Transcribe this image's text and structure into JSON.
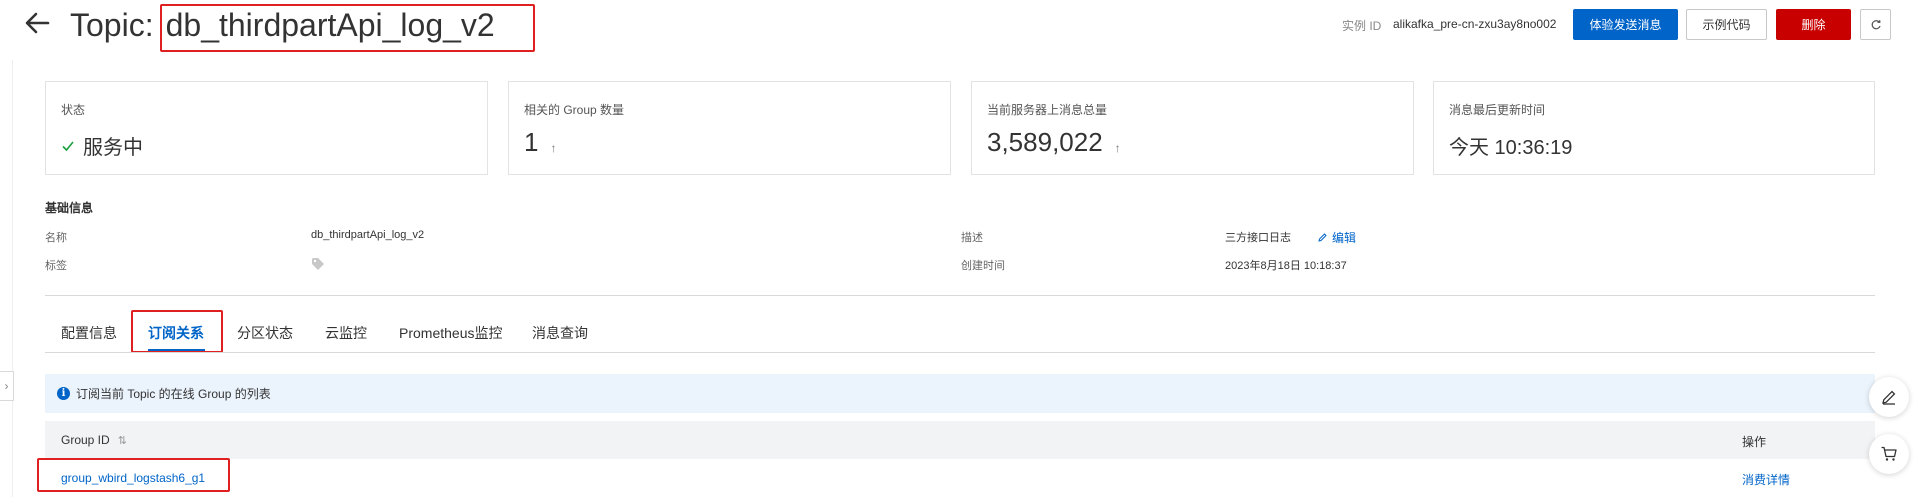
{
  "header": {
    "title_prefix": "Topic:",
    "topic_name": "db_thirdpartApi_log_v2",
    "instance_label": "实例 ID",
    "instance_id": "alikafka_pre-cn-zxu3ay8no002",
    "buttons": {
      "send_message": "体验发送消息",
      "sample_code": "示例代码",
      "delete": "删除"
    }
  },
  "stats": [
    {
      "label": "状态",
      "value": "服务中"
    },
    {
      "label": "相关的 Group 数量",
      "value": "1"
    },
    {
      "label": "当前服务器上消息总量",
      "value": "3,589,022"
    },
    {
      "label": "消息最后更新时间",
      "value": "今天 10:36:19"
    }
  ],
  "basic_info": {
    "title": "基础信息",
    "name_label": "名称",
    "name_value": "db_thirdpartApi_log_v2",
    "tag_label": "标签",
    "desc_label": "描述",
    "desc_value": "三方接口日志",
    "edit_label": "编辑",
    "created_label": "创建时间",
    "created_value": "2023年8月18日 10:18:37"
  },
  "tabs": [
    "配置信息",
    "订阅关系",
    "分区状态",
    "云监控",
    "Prometheus监控",
    "消息查询"
  ],
  "active_tab": 1,
  "notice": "订阅当前 Topic 的在线 Group 的列表",
  "table": {
    "columns": [
      "Group ID",
      "操作"
    ],
    "rows": [
      {
        "group_id": "group_wbird_logstash6_g1",
        "action": "消费详情"
      }
    ]
  },
  "colors": {
    "primary": "#0064c8",
    "danger": "#c80000",
    "highlight": "#e02020",
    "success": "#1aa040"
  },
  "icons": [
    "back-arrow-icon",
    "refresh-icon",
    "check-icon",
    "arrow-up-icon",
    "tag-icon",
    "edit-icon",
    "info-icon",
    "sort-icon",
    "chevron-right-icon",
    "pen-icon",
    "cart-icon"
  ]
}
